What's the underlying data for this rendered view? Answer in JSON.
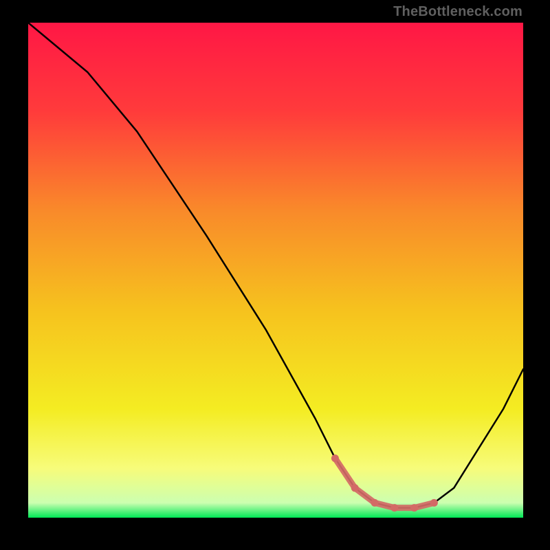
{
  "watermark": "TheBottleneck.com",
  "chart_data": {
    "type": "line",
    "title": "",
    "xlabel": "",
    "ylabel": "",
    "xlim": [
      0,
      100
    ],
    "ylim": [
      0,
      100
    ],
    "grid": false,
    "series": [
      {
        "name": "curve",
        "x": [
          0,
          6,
          12,
          22,
          36,
          48,
          58,
          62,
          66,
          70,
          74,
          78,
          82,
          86,
          96,
          100
        ],
        "values": [
          100,
          95,
          90,
          78,
          57,
          38,
          20,
          12,
          6,
          3,
          2,
          2,
          3,
          6,
          22,
          30
        ]
      }
    ],
    "highlight_segment": {
      "name": "marker-band",
      "color": "#d36a66",
      "x": [
        62,
        66,
        70,
        74,
        78,
        82
      ],
      "values": [
        12,
        6,
        3,
        2,
        2,
        3
      ]
    },
    "gradient_stops": [
      {
        "offset": 0.0,
        "color": "#ff1745"
      },
      {
        "offset": 0.18,
        "color": "#ff3b3b"
      },
      {
        "offset": 0.38,
        "color": "#f98a2a"
      },
      {
        "offset": 0.58,
        "color": "#f6c21e"
      },
      {
        "offset": 0.78,
        "color": "#f4ec22"
      },
      {
        "offset": 0.9,
        "color": "#f7fc7a"
      },
      {
        "offset": 0.97,
        "color": "#ccffb0"
      },
      {
        "offset": 1.0,
        "color": "#00e756"
      }
    ]
  }
}
